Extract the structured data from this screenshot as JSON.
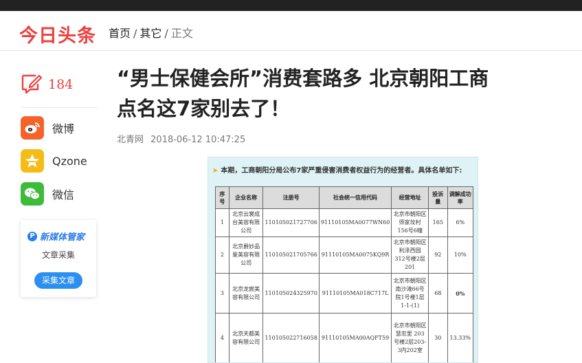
{
  "header": {
    "logo": "今日头条",
    "breadcrumb": [
      "首页",
      "其它",
      "正文"
    ],
    "separator": "/"
  },
  "sidebar": {
    "comment_count": "184",
    "share": [
      {
        "label": "微博",
        "icon": "weibo-icon",
        "color": "#f5632b"
      },
      {
        "label": "Qzone",
        "icon": "qzone-icon",
        "color": "#f5bb16"
      },
      {
        "label": "微信",
        "icon": "wechat-icon",
        "color": "#3fbb3c"
      }
    ],
    "card": {
      "brand": "新媒体管家",
      "subtitle": "文章采集",
      "button": "采集文章"
    }
  },
  "article": {
    "title_line1": "“男士保健会所”消费套路多 北京朝阳工商",
    "title_line2": "点名这7家别去了！",
    "source": "北青网",
    "time": "2018-06-12 10:47:25"
  },
  "image": {
    "intro": "本期，工商朝阳分局公布7家严重侵害消费者权益行为的经营者。具体名单如下:",
    "headers": [
      "序号",
      "企业名称",
      "注册号",
      "社会统一信用代码",
      "经营地址",
      "投诉量",
      "调解成功率"
    ],
    "rows": [
      [
        "1",
        "北京云裳成台美容有限公司",
        "110105021727706",
        "91110105MA0077WN60",
        "北京市朝阳区师家坟村 156号6幢",
        "165",
        "6%"
      ],
      [
        "2",
        "北京爵妙品鉴美容有限公司",
        "110105021705766",
        "91110105MA0075KQ9R",
        "北京市朝阳区利泽西园 312号楼2层201",
        "92",
        "10%"
      ],
      [
        "3",
        "北京龙宸美容有限公司",
        "110105024325970",
        "91110105MA018C717L",
        "北京市朝阳区南沙滩66号院1号楼1层1-1-(1)",
        "68",
        "0%"
      ],
      [
        "4",
        "北京天都美容有限公司",
        "110105022716058",
        "91110105MA00AQFT59",
        "北京市朝阳区慧忠里 203号楼2层203-3内202室",
        "30",
        "13.33%"
      ]
    ]
  }
}
